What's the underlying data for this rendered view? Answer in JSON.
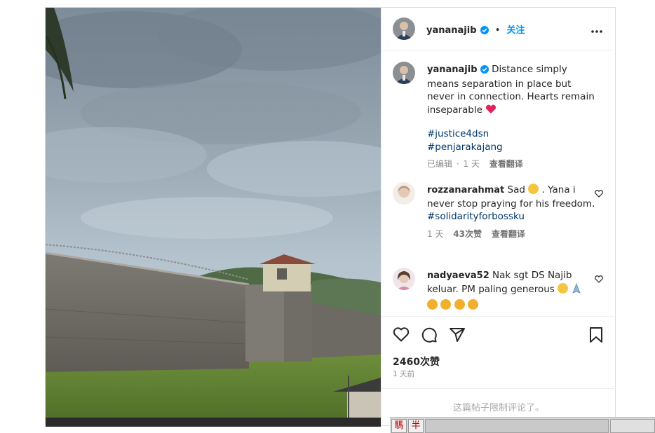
{
  "post": {
    "username": "yananajib",
    "separator": "•",
    "follow_label": "关注",
    "caption_text": "Distance simply means separation in place but never in connection. Hearts remain inseparable",
    "hashtags": [
      "#justice4dsn",
      "#penjarakajang"
    ],
    "caption_meta": {
      "edited": "已编辑",
      "dot": "·",
      "time": "1 天",
      "translate": "查看翻译"
    },
    "likes": "2460次赞",
    "posted_ago": "1 天前",
    "comments_limited": "这篇帖子限制评论了。"
  },
  "comments": [
    {
      "username": "rozzanarahmat",
      "text_a": "Sad",
      "text_b": ". Yana i never stop praying for his freedom.",
      "hashtag": "#solidarityforbossku",
      "time": "1 天",
      "likes": "43次赞",
      "translate": "查看翻译"
    },
    {
      "username": "nadyaeva52",
      "text": "Nak sgt DS Najib keluar. PM paling generous"
    }
  ],
  "taskbar": {
    "char1": "騳",
    "char2": "半"
  },
  "colors": {
    "link": "#0095f6",
    "hashtag": "#00376b",
    "text": "#262626",
    "meta": "#8e8e8e",
    "heart": "#ed4956"
  }
}
